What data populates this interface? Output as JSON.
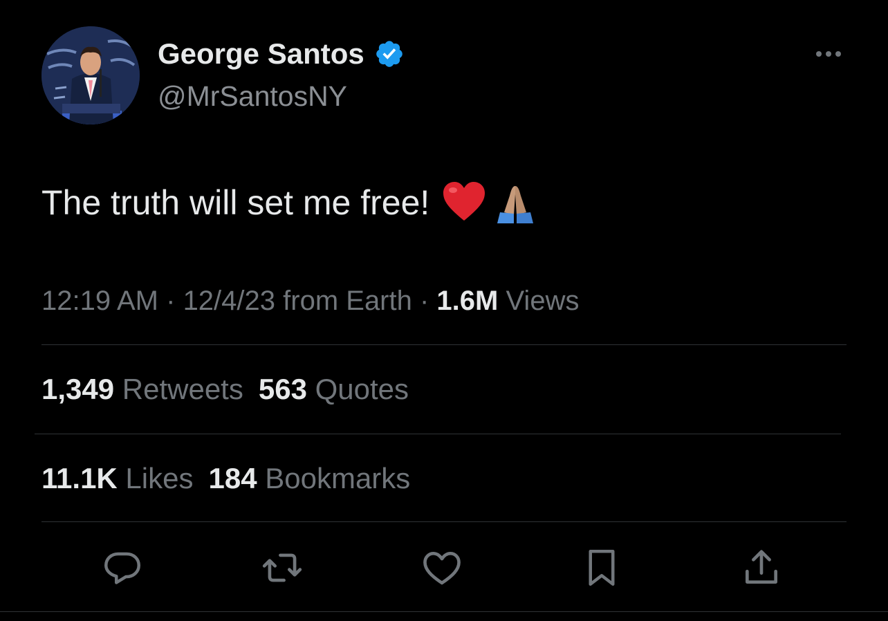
{
  "author": {
    "display_name": "George Santos",
    "handle": "@MrSantosNY",
    "verified_icon": "verified-badge-icon",
    "verified_color": "#1d9bf0",
    "avatar": "profile-photo"
  },
  "tweet": {
    "text": "The truth will set me free!",
    "emojis": [
      "red-heart",
      "folded-hands"
    ]
  },
  "meta": {
    "time": "12:19 AM",
    "sep1": " · ",
    "date": "12/4/23",
    "from": " from Earth",
    "sep2": " · ",
    "views_count": "1.6M",
    "views_label": " Views"
  },
  "stats": {
    "retweets_count": "1,349",
    "retweets_label": " Retweets",
    "quotes_count": "563",
    "quotes_label": " Quotes",
    "likes_count": "11.1K",
    "likes_label": " Likes",
    "bookmarks_count": "184",
    "bookmarks_label": " Bookmarks"
  },
  "actions": [
    "reply-icon",
    "retweet-icon",
    "like-icon",
    "bookmark-icon",
    "share-icon"
  ],
  "colors": {
    "background": "#000000",
    "primary_text": "#e7e9ea",
    "secondary_text": "#71767b",
    "divider": "#2f3336"
  }
}
